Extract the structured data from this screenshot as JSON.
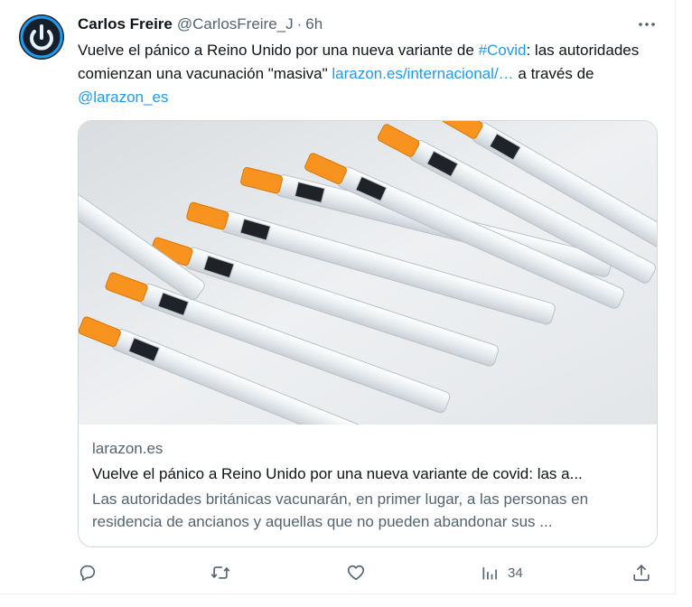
{
  "tweet": {
    "author_name": "Carlos Freire",
    "author_handle": "@CarlosFreire_J",
    "separator": "·",
    "time": "6h",
    "avatar_icon": "power-icon",
    "text_parts": {
      "p1": "Vuelve el pánico a Reino Unido por una nueva variante de ",
      "hashtag": "#Covid",
      "p2": ": las autoridades comienzan una vacunación \"masiva\" ",
      "link": "larazon.es/internacional/…",
      "p3": " a través de ",
      "mention": "@larazon_es"
    }
  },
  "card": {
    "image_alt": "syringes with orange caps",
    "domain": "larazon.es",
    "title": "Vuelve el pánico a Reino Unido por una nueva variante de covid: las a...",
    "description": "Las autoridades británicas vacunarán, en primer lugar, a las personas en residencia de ancianos y aquellas que no pueden abandonar sus ..."
  },
  "actions": {
    "reply_icon": "reply-icon",
    "retweet_icon": "retweet-icon",
    "like_icon": "heart-icon",
    "views_icon": "bar-chart-icon",
    "views_count": "34",
    "share_icon": "share-icon"
  },
  "colors": {
    "link": "#1d9bf0",
    "secondary_text": "#536471",
    "primary_text": "#0f1419",
    "border": "#cfd9de",
    "avatar_bg": "#15202b",
    "avatar_ring": "#1d9bf0"
  }
}
